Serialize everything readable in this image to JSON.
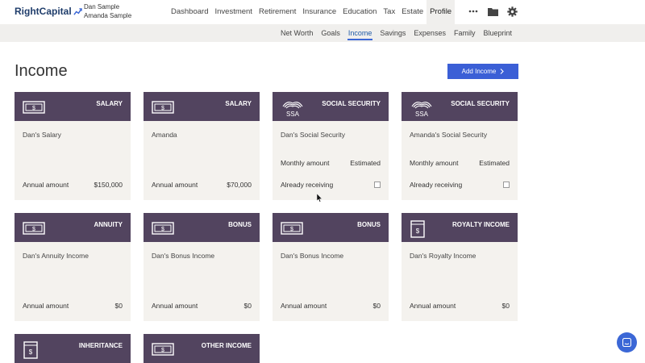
{
  "app": {
    "logo_text": "RightCapital",
    "users": [
      "Dan Sample",
      "Amanda Sample"
    ]
  },
  "main_nav": [
    "Dashboard",
    "Investment",
    "Retirement",
    "Insurance",
    "Education",
    "Tax",
    "Estate",
    "Profile"
  ],
  "main_nav_active": "Profile",
  "top_icons": [
    "more-icon",
    "folder-icon",
    "gear-icon"
  ],
  "sub_nav": [
    "Net Worth",
    "Goals",
    "Income",
    "Savings",
    "Expenses",
    "Family",
    "Blueprint"
  ],
  "sub_nav_active": "Income",
  "page": {
    "title": "Income",
    "add_button": "Add Income"
  },
  "cards": [
    {
      "type": "SALARY",
      "icon": "money-icon",
      "name": "Dan's Salary",
      "row_a": null,
      "row_b": {
        "label": "Annual amount",
        "value": "$150,000"
      }
    },
    {
      "type": "SALARY",
      "icon": "money-icon",
      "name": "Amanda",
      "row_a": null,
      "row_b": {
        "label": "Annual amount",
        "value": "$70,000"
      }
    },
    {
      "type": "SOCIAL SECURITY",
      "icon": "ssa-icon",
      "name": "Dan's Social Security",
      "row_a": {
        "label": "Monthly amount",
        "value": "Estimated"
      },
      "row_b": {
        "label": "Already receiving",
        "checkbox": true
      }
    },
    {
      "type": "SOCIAL SECURITY",
      "icon": "ssa-icon",
      "name": "Amanda's Social Security",
      "row_a": {
        "label": "Monthly amount",
        "value": "Estimated"
      },
      "row_b": {
        "label": "Already receiving",
        "checkbox": true
      }
    },
    {
      "type": "ANNUITY",
      "icon": "money-icon",
      "name": "Dan's Annuity Income",
      "row_a": null,
      "row_b": {
        "label": "Annual amount",
        "value": "$0"
      }
    },
    {
      "type": "BONUS",
      "icon": "money-icon",
      "name": "Dan's Bonus Income",
      "row_a": null,
      "row_b": {
        "label": "Annual amount",
        "value": "$0"
      }
    },
    {
      "type": "BONUS",
      "icon": "money-icon",
      "name": "Dan's Bonus Income",
      "row_a": null,
      "row_b": {
        "label": "Annual amount",
        "value": "$0"
      }
    },
    {
      "type": "ROYALTY INCOME",
      "icon": "document-money-icon",
      "name": "Dan's Royalty Income",
      "row_a": null,
      "row_b": {
        "label": "Annual amount",
        "value": "$0"
      }
    },
    {
      "type": "INHERITANCE",
      "icon": "document-money-icon"
    },
    {
      "type": "OTHER INCOME",
      "icon": "money-icon"
    }
  ],
  "colors": {
    "card_header": "#52445f",
    "card_body": "#f4f2ee",
    "accent": "#3b5fd6"
  }
}
